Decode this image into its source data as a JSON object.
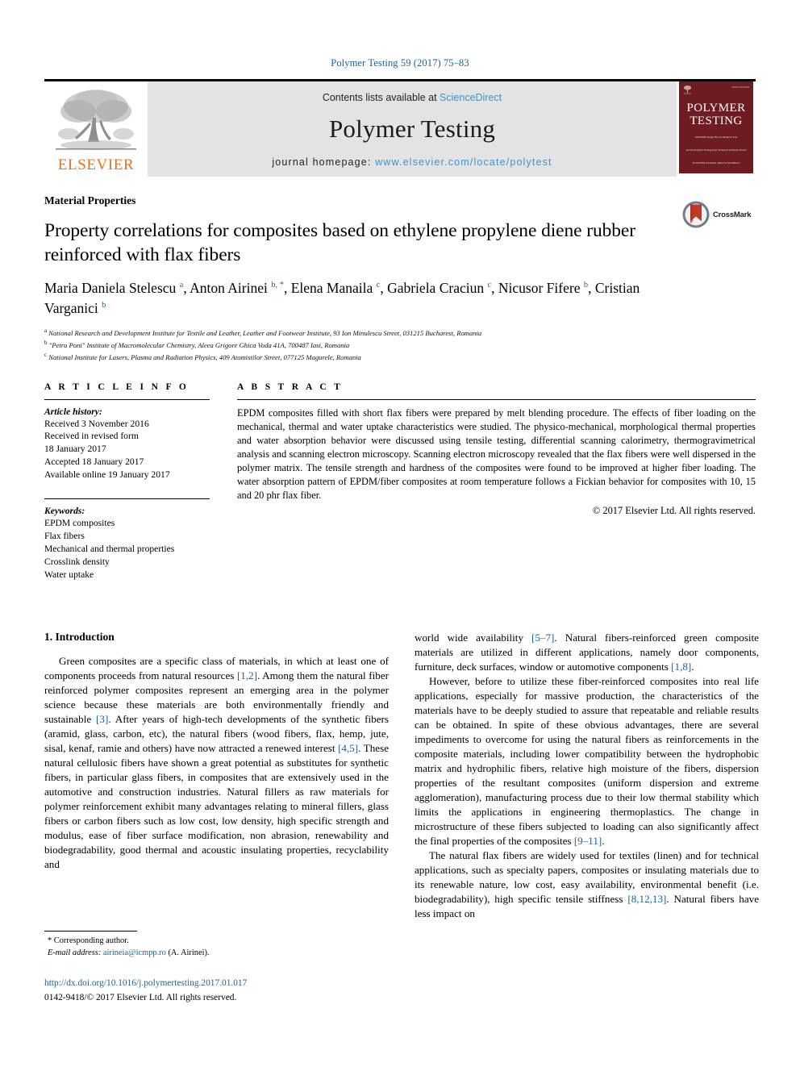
{
  "running_head": "Polymer Testing 59 (2017) 75–83",
  "masthead": {
    "publisher_name": "ELSEVIER",
    "contents_prefix": "Contents lists available at ",
    "contents_link": "ScienceDirect",
    "journal_name": "Polymer Testing",
    "homepage_prefix": "journal homepage: ",
    "homepage_url": "www.elsevier.com/locate/polytest",
    "cover": {
      "title_line1": "POLYMER",
      "title_line2": "TESTING",
      "sub_block1": "EDITORS\nRoger Brown\nMaterial Test",
      "sub_block2": "ALSO\nPolymer Testing\nKey Technical Advisory Board",
      "sub_block3": "ELSEVIER\nAvailable online\nScienceDirect",
      "code": "ISSN 0142-9418"
    }
  },
  "article": {
    "kicker": "Material Properties",
    "title": "Property correlations for composites based on ethylene propylene diene rubber reinforced with flax fibers",
    "crossmark_label": "CrossMark",
    "authors_html": "Maria Daniela Stelescu <sup>a</sup>, Anton Airinei <sup>b, *</sup>, Elena Manaila <sup>c</sup>, Gabriela Craciun <sup>c</sup>, Nicusor Fifere <sup>b</sup>, Cristian Varganici <sup>b</sup>",
    "affiliations": [
      {
        "mark": "a",
        "text": "National Research and Development Institute for Textile and Leather, Leather and Footwear Institute, 93 Ion Minulescu Street, 031215 Bucharest, Romania"
      },
      {
        "mark": "b",
        "text": "\"Petru Poni\" Institute of Macromolecular Chemistry, Aleea Grigore Ghica Voda 41A, 700487 Iasi, Romania"
      },
      {
        "mark": "c",
        "text": "National Institute for Lasers, Plasma and Radiation Physics, 409 Atomistilor Street, 077125 Magurele, Romania"
      }
    ]
  },
  "article_info": {
    "heading": "A R T I C L E   I N F O",
    "history_title": "Article history:",
    "history": [
      "Received 3 November 2016",
      "Received in revised form",
      "18 January 2017",
      "Accepted 18 January 2017",
      "Available online 19 January 2017"
    ],
    "keywords_title": "Keywords:",
    "keywords": [
      "EPDM composites",
      "Flax fibers",
      "Mechanical and thermal properties",
      "Crosslink density",
      "Water uptake"
    ]
  },
  "abstract": {
    "heading": "A B S T R A C T",
    "text": "EPDM composites filled with short flax fibers were prepared by melt blending procedure. The effects of fiber loading on the mechanical, thermal and water uptake characteristics were studied. The physico-mechanical, morphological thermal properties and water absorption behavior were discussed using tensile testing, differential scanning calorimetry, thermogravimetrical analysis and scanning electron microscopy. Scanning electron microscopy revealed that the flax fibers were well dispersed in the polymer matrix. The tensile strength and hardness of the composites were found to be improved at higher fiber loading. The water absorption pattern of EPDM/fiber composites at room temperature follows a Fickian behavior for composites with 10, 15 and 20 phr flax fiber.",
    "copyright": "© 2017 Elsevier Ltd. All rights reserved."
  },
  "body": {
    "section_heading": "1. Introduction",
    "left_paragraph_1_html": "Green composites are a specific class of materials, in which at least one of components proceeds from natural resources <span class=\"ref\">[1,2]</span>. Among them the natural fiber reinforced polymer composites represent an emerging area in the polymer science because these materials are both environmentally friendly and sustainable <span class=\"ref\">[3]</span>. After years of high-tech developments of the synthetic fibers (aramid, glass, carbon, etc), the natural fibers (wood fibers, flax, hemp, jute, sisal, kenaf, ramie and others) have now attracted a renewed interest <span class=\"ref\">[4,5]</span>. These natural cellulosic fibers have shown a great potential as substitutes for synthetic fibers, in particular glass fibers, in composites that are extensively used in the automotive and construction industries. Natural fillers as raw materials for polymer reinforcement exhibit many advantages relating to mineral fillers, glass fibers or carbon fibers such as low cost, low density, high specific strength and modulus, ease of fiber surface modification, non abrasion, renewability and biodegradability, good thermal and acoustic insulating properties, recyclability and",
    "right_paragraph_1_html": "world wide availability <span class=\"ref\">[5–7]</span>. Natural fibers-reinforced green composite materials are utilized in different applications, namely door components, furniture, deck surfaces, window or automotive components <span class=\"ref\">[1,8]</span>.",
    "right_paragraph_2_html": "However, before to utilize these fiber-reinforced composites into real life applications, especially for massive production, the characteristics of the materials have to be deeply studied to assure that repeatable and reliable results can be obtained. In spite of these obvious advantages, there are several impediments to overcome for using the natural fibers as reinforcements in the composite materials, including lower compatibility between the hydrophobic matrix and hydrophilic fibers, relative high moisture of the fibers, dispersion properties of the resultant composites (uniform dispersion and extreme agglomeration), manufacturing process due to their low thermal stability which limits the applications in engineering thermoplastics. The change in microstructure of these fibers subjected to loading can also significantly affect the final properties of the composites <span class=\"ref\">[9–11]</span>.",
    "right_paragraph_3_html": "The natural flax fibers are widely used for textiles (linen) and for technical applications, such as specialty papers, composites or insulating materials due to its renewable nature, low cost, easy availability, environmental benefit (i.e. biodegradability), high specific tensile stiffness <span class=\"ref\">[8,12,13]</span>. Natural fibers have less impact on"
  },
  "footer": {
    "corresponding_author": "* Corresponding author.",
    "email_label": "E-mail address:",
    "email": "airineia@icmpp.ro",
    "email_suffix": "(A. Airinei).",
    "doi": "http://dx.doi.org/10.1016/j.polymertesting.2017.01.017",
    "issn_copyright": "0142-9418/© 2017 Elsevier Ltd. All rights reserved."
  },
  "colors": {
    "link_blue": "#1a6496",
    "banner_link": "#4a8fc4",
    "elsevier_orange": "#E9711C",
    "cover_maroon": "#6d1c22",
    "banner_grey": "#e3e3e3"
  }
}
